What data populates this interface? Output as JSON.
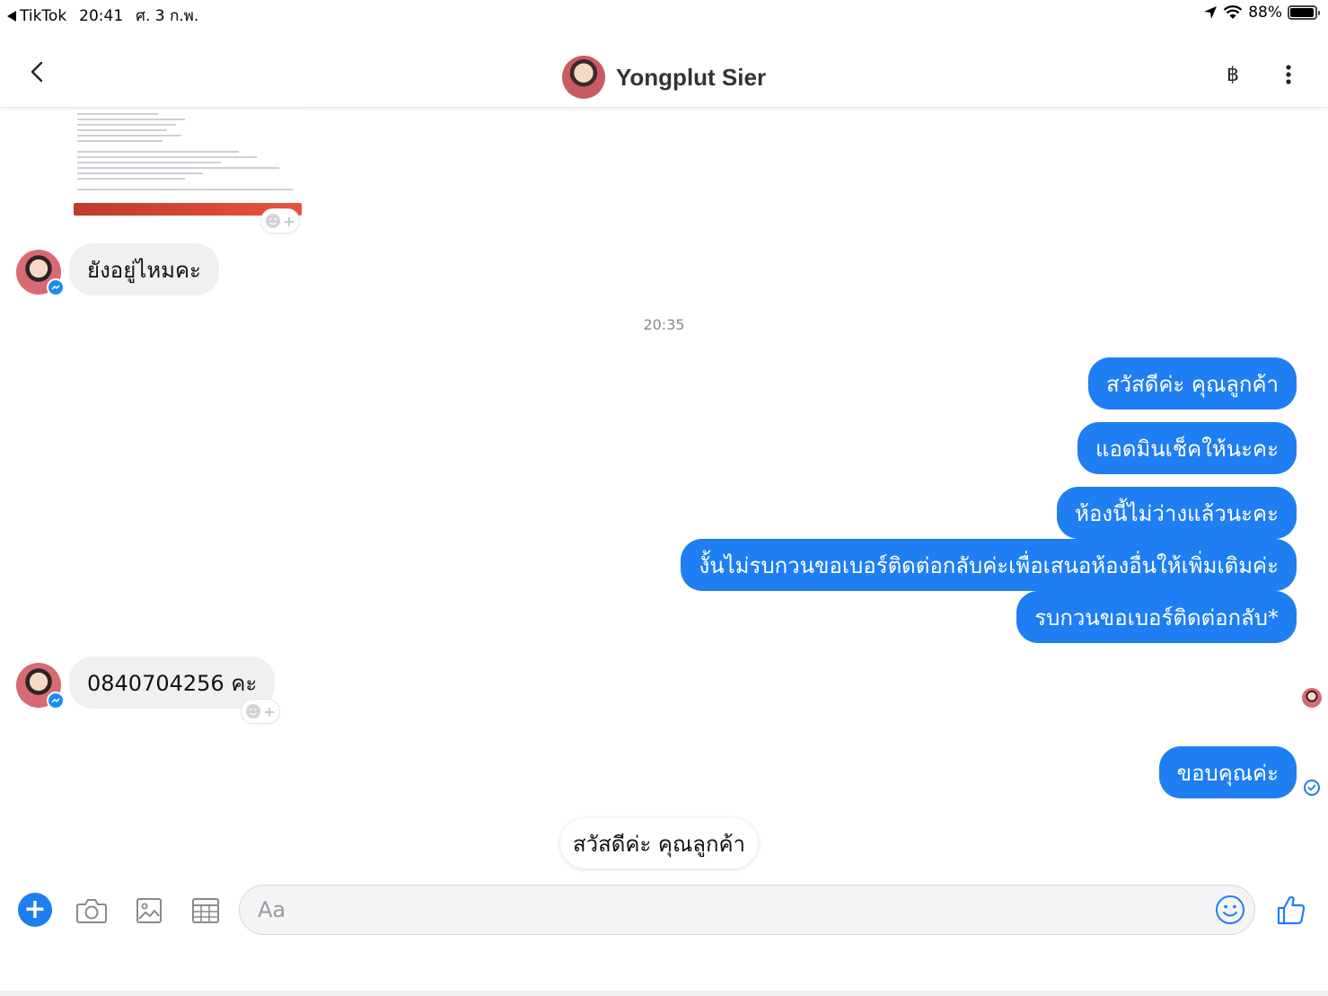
{
  "status_bar": {
    "back_app": "TikTok",
    "time": "20:41",
    "date": "ศ. 3 ก.พ.",
    "battery": "88%",
    "battery_level": 0.88
  },
  "header": {
    "contact_name": "Yongplut Sier",
    "currency_icon": "฿"
  },
  "messages": {
    "in_1": "ยังอยู่ไหมคะ",
    "timestamp": "20:35",
    "out_1": "สวัสดีค่ะ คุณลูกค้า",
    "out_2": "แอดมินเช็คให้นะคะ",
    "out_3": "ห้องนี้ไม่ว่างแล้วนะคะ",
    "out_4": "งั้นไม่รบกวนขอเบอร์ติดต่อกลับค่ะเพื่อเสนอห้องอื่นให้เพิ่มเติมค่ะ",
    "out_5": "รบกวนขอเบอร์ติดต่อกลับ*",
    "in_2": "0840704256 คะ",
    "out_6": "ขอบคุณค่ะ"
  },
  "quick_reply": "สวัสดีค่ะ คุณลูกค้า",
  "composer": {
    "placeholder": "Aa"
  },
  "colors": {
    "accent": "#1f7ef2",
    "incoming_bubble": "#f0f0f0"
  }
}
